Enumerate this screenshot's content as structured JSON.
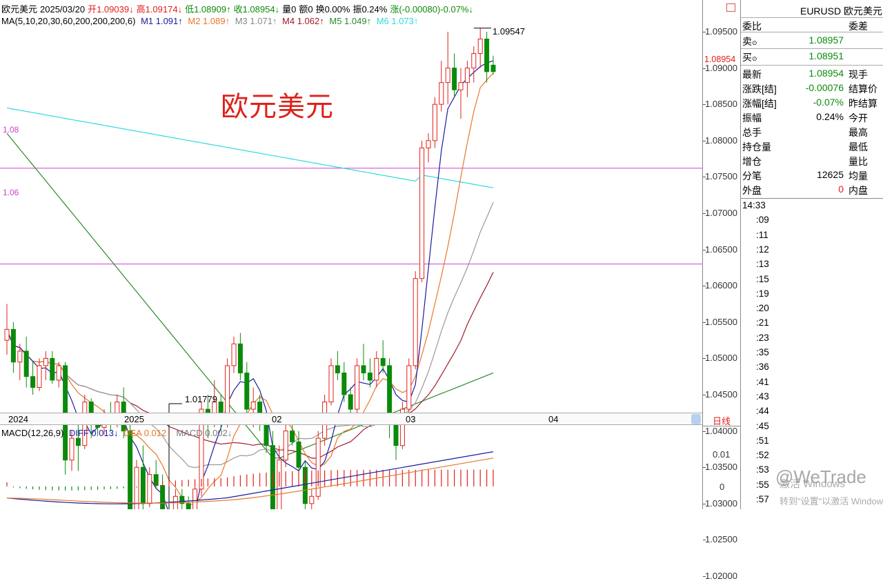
{
  "header": {
    "name": "欧元美元",
    "date": "2025/03/20",
    "open": "开1.09039↓",
    "high": "高1.09174↓",
    "low": "低1.08909↑",
    "close": "收1.08954↓",
    "volume": "量0",
    "amount": "额0",
    "turnover": "换0.00%",
    "amplitude": "振0.24%",
    "change": "涨(-0.00080)-0.07%↓"
  },
  "ma_legend": {
    "title": "MA(5,10,20,30,60,200,200,200,6)",
    "m1": "M1 1.091↑",
    "m2": "M2 1.089↑",
    "m3": "M3 1.071↑",
    "m4": "M4 1.062↑",
    "m5": "M5 1.049↑",
    "m6": "M6 1.073↑"
  },
  "chart_title": "欧元美元",
  "annotations": {
    "high": "1.09547",
    "low": "1.01779",
    "h1": "1.08",
    "h2": "1.06"
  },
  "price_axis": [
    "1.09500",
    "1.09000",
    "1.08500",
    "1.08000",
    "1.07500",
    "1.07000",
    "1.06500",
    "1.06000",
    "1.05500",
    "1.05000",
    "1.04500",
    "1.04000",
    "1.03500",
    "1.03000",
    "1.02500",
    "1.02000"
  ],
  "current_price": "1.08954",
  "time_axis": [
    "2024",
    "2025",
    "02",
    "03",
    "04"
  ],
  "period_label": "日线",
  "macd_legend": {
    "title": "MACD(12,26,9)",
    "diff": "DIFF 0.013↓",
    "dea": "DEA 0.012↑",
    "macd": "MACD 0.002↓"
  },
  "macd_axis": [
    "0.01",
    "0"
  ],
  "colors": {
    "up": "#e0201a",
    "down": "#0a8a0a",
    "m1": "#1a1aa0",
    "m2": "#e8762a",
    "m3": "#999999",
    "m4": "#a01a2a",
    "m5": "#2a8a2a",
    "m6": "#30d8e0",
    "hline": "#d040d0"
  },
  "side": {
    "symbol": "EURUSD 欧元美元",
    "weibi": "委比",
    "weicha": "委差",
    "sell_label": "卖",
    "sell_value": "1.08957",
    "buy_label": "买",
    "buy_value": "1.08951",
    "rows": [
      {
        "k": "最新",
        "v": "1.08954",
        "k2": "现手",
        "c": "green"
      },
      {
        "k": "涨跌[结]",
        "v": "-0.00076",
        "k2": "结算价",
        "c": "green"
      },
      {
        "k": "涨幅[结]",
        "v": "-0.07%",
        "k2": "昨结算",
        "c": "green"
      },
      {
        "k": "振幅",
        "v": "0.24%",
        "k2": "今开",
        "c": ""
      },
      {
        "k": "总手",
        "v": "",
        "k2": "最高",
        "c": ""
      },
      {
        "k": "持仓量",
        "v": "",
        "k2": "最低",
        "c": ""
      },
      {
        "k": "增仓",
        "v": "",
        "k2": "量比",
        "c": ""
      },
      {
        "k": "分笔",
        "v": "12625",
        "k2": "均量",
        "c": ""
      },
      {
        "k": "外盘",
        "v": "0",
        "k2": "内盘",
        "c": "red"
      }
    ],
    "times": [
      "14:33",
      ":09",
      ":11",
      ":12",
      ":13",
      ":15",
      ":19",
      ":20",
      ":21",
      ":23",
      ":35",
      ":36",
      ":41",
      ":43",
      ":44",
      ":45",
      ":51",
      ":52",
      ":53",
      ":55",
      ":57"
    ]
  },
  "watermark": {
    "line1": "激活 Windows",
    "line2": "转到\"设置\"以激活 Windows",
    "brand": "@WeTrade"
  },
  "chart_data": {
    "type": "candlestick",
    "title": "欧元美元",
    "ylim": [
      1.0165,
      1.0995
    ],
    "ohlc": [
      [
        1.0525,
        1.0575,
        1.0505,
        1.054
      ],
      [
        1.054,
        1.055,
        1.048,
        1.0495
      ],
      [
        1.0495,
        1.052,
        1.047,
        1.051
      ],
      [
        1.051,
        1.053,
        1.046,
        1.0475
      ],
      [
        1.0475,
        1.0495,
        1.045,
        1.046
      ],
      [
        1.046,
        1.05,
        1.0455,
        1.049
      ],
      [
        1.049,
        1.051,
        1.047,
        1.05
      ],
      [
        1.05,
        1.051,
        1.0465,
        1.047
      ],
      [
        1.047,
        1.0495,
        1.046,
        1.049
      ],
      [
        1.049,
        1.0495,
        1.034,
        1.036
      ],
      [
        1.036,
        1.04,
        1.0345,
        1.039
      ],
      [
        1.039,
        1.042,
        1.0345,
        1.038
      ],
      [
        1.038,
        1.045,
        1.0375,
        1.044
      ],
      [
        1.044,
        1.0445,
        1.039,
        1.041
      ],
      [
        1.041,
        1.042,
        1.0395,
        1.0405
      ],
      [
        1.0405,
        1.043,
        1.0395,
        1.042
      ],
      [
        1.042,
        1.044,
        1.04,
        1.041
      ],
      [
        1.041,
        1.045,
        1.0405,
        1.044
      ],
      [
        1.044,
        1.046,
        1.039,
        1.04
      ],
      [
        1.04,
        1.041,
        1.027,
        1.029
      ],
      [
        1.029,
        1.036,
        1.028,
        1.035
      ],
      [
        1.035,
        1.038,
        1.029,
        1.03
      ],
      [
        1.03,
        1.035,
        1.0295,
        1.034
      ],
      [
        1.034,
        1.036,
        1.032,
        1.0325
      ],
      [
        1.0325,
        1.034,
        1.023,
        1.025
      ],
      [
        1.025,
        1.0255,
        1.0178,
        1.022
      ],
      [
        1.022,
        1.032,
        1.0215,
        1.031
      ],
      [
        1.031,
        1.032,
        1.029,
        1.03
      ],
      [
        1.03,
        1.031,
        1.027,
        1.029
      ],
      [
        1.029,
        1.033,
        1.028,
        1.032
      ],
      [
        1.032,
        1.044,
        1.031,
        1.043
      ],
      [
        1.043,
        1.045,
        1.039,
        1.042
      ],
      [
        1.042,
        1.047,
        1.0405,
        1.044
      ],
      [
        1.044,
        1.045,
        1.04,
        1.041
      ],
      [
        1.041,
        1.05,
        1.0405,
        1.049
      ],
      [
        1.049,
        1.053,
        1.048,
        1.052
      ],
      [
        1.052,
        1.0535,
        1.047,
        1.048
      ],
      [
        1.048,
        1.0495,
        1.041,
        1.043
      ],
      [
        1.043,
        1.046,
        1.0405,
        1.044
      ],
      [
        1.044,
        1.045,
        1.04,
        1.041
      ],
      [
        1.041,
        1.042,
        1.037,
        1.038
      ],
      [
        1.038,
        1.04,
        1.021,
        1.023
      ],
      [
        1.023,
        1.038,
        1.0225,
        1.036
      ],
      [
        1.036,
        1.041,
        1.035,
        1.04
      ],
      [
        1.04,
        1.042,
        1.038,
        1.0385
      ],
      [
        1.0385,
        1.04,
        1.034,
        1.035
      ],
      [
        1.035,
        1.036,
        1.029,
        1.03
      ],
      [
        1.03,
        1.032,
        1.0285,
        1.031
      ],
      [
        1.031,
        1.04,
        1.0305,
        1.039
      ],
      [
        1.039,
        1.045,
        1.038,
        1.044
      ],
      [
        1.044,
        1.05,
        1.0435,
        1.049
      ],
      [
        1.049,
        1.051,
        1.047,
        1.048
      ],
      [
        1.048,
        1.0495,
        1.044,
        1.045
      ],
      [
        1.045,
        1.046,
        1.041,
        1.043
      ],
      [
        1.043,
        1.05,
        1.0425,
        1.049
      ],
      [
        1.049,
        1.052,
        1.047,
        1.048
      ],
      [
        1.048,
        1.05,
        1.046,
        1.047
      ],
      [
        1.047,
        1.051,
        1.046,
        1.05
      ],
      [
        1.05,
        1.0525,
        1.048,
        1.049
      ],
      [
        1.049,
        1.05,
        1.039,
        1.041
      ],
      [
        1.041,
        1.042,
        1.036,
        1.038
      ],
      [
        1.038,
        1.044,
        1.0375,
        1.043
      ],
      [
        1.043,
        1.05,
        1.0425,
        1.049
      ],
      [
        1.049,
        1.062,
        1.0485,
        1.061
      ],
      [
        1.061,
        1.08,
        1.0605,
        1.079
      ],
      [
        1.079,
        1.081,
        1.077,
        1.08
      ],
      [
        1.08,
        1.086,
        1.079,
        1.085
      ],
      [
        1.085,
        1.091,
        1.084,
        1.088
      ],
      [
        1.088,
        1.095,
        1.085,
        1.09
      ],
      [
        1.09,
        1.092,
        1.086,
        1.087
      ],
      [
        1.087,
        1.09,
        1.083,
        1.088
      ],
      [
        1.088,
        1.091,
        1.086,
        1.09
      ],
      [
        1.09,
        1.093,
        1.088,
        1.092
      ],
      [
        1.092,
        1.0955,
        1.09,
        1.094
      ],
      [
        1.094,
        1.095,
        1.088,
        1.0895
      ],
      [
        1.0904,
        1.0917,
        1.0891,
        1.0895
      ]
    ],
    "hlines": [
      1.0762,
      1.063
    ]
  }
}
